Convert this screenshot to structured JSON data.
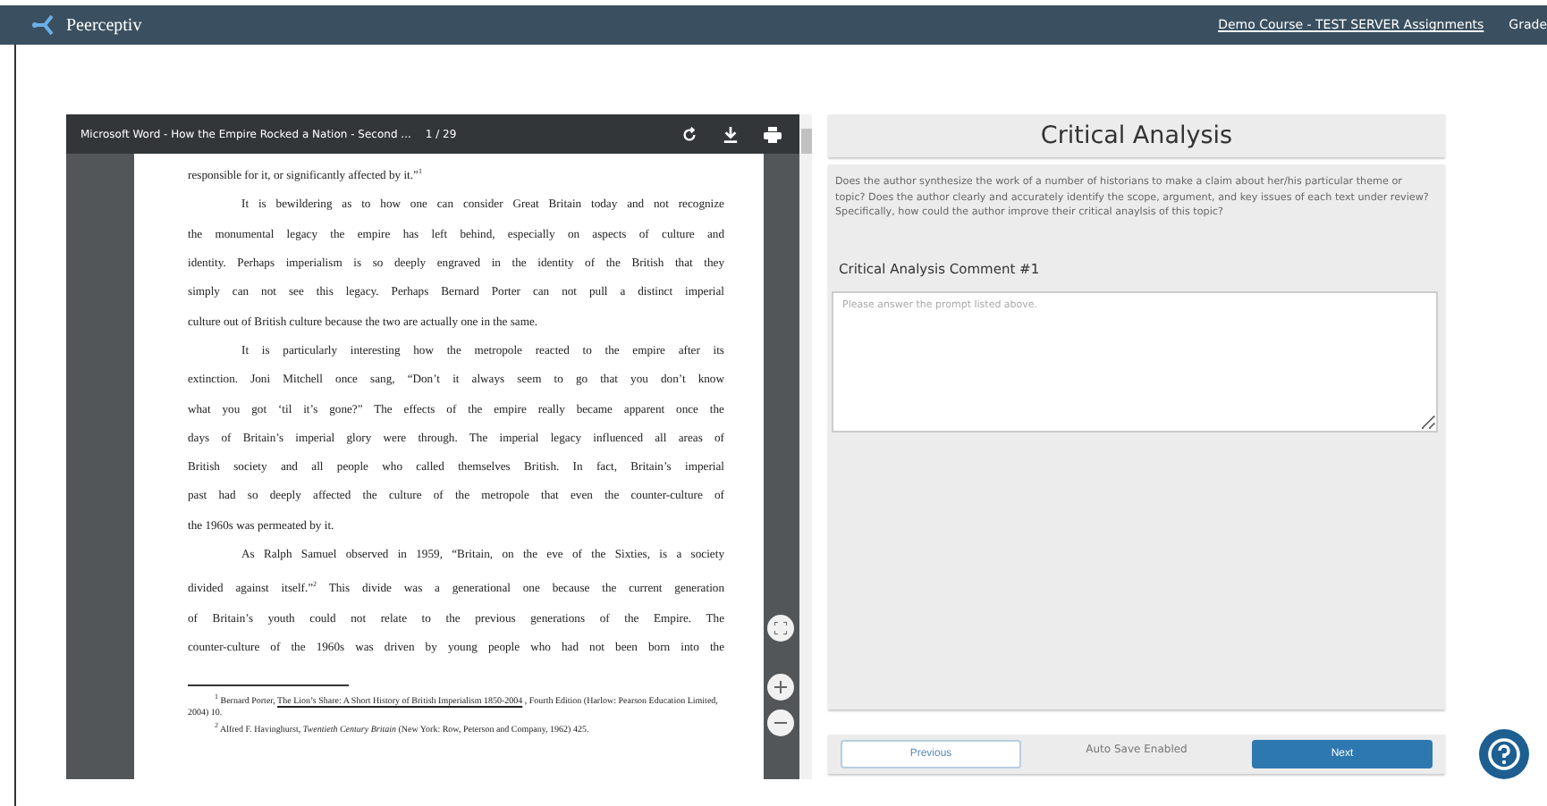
{
  "navbar": {
    "brand": "Peerceptiv",
    "course_link": "Demo Course - TEST SERVER Assignments",
    "grades_link": "Grade"
  },
  "pdf_viewer": {
    "title": "Microsoft Word - How the Empire Rocked a Nation - Second ...",
    "page_counter": "1 / 29",
    "lines": [
      {
        "kind": "last",
        "text": "responsible for it, or significantly affected by it.”$^{1}$"
      },
      {
        "kind": "indent",
        "text": "It is bewildering as to how one can consider Great Britain today and not recognize"
      },
      {
        "kind": "justify",
        "text": "the monumental legacy the empire has left behind, especially on aspects of culture and"
      },
      {
        "kind": "justify",
        "text": "identity. Perhaps imperialism is so deeply engraved in the identity of the British that they"
      },
      {
        "kind": "justify",
        "text": "simply can not see this legacy. Perhaps Bernard Porter can not pull a distinct imperial"
      },
      {
        "kind": "last",
        "text": "culture out of British culture because the two are actually one in the same."
      },
      {
        "kind": "indent",
        "text": "It is particularly interesting how the metropole reacted to the empire after its"
      },
      {
        "kind": "justify",
        "text": "extinction. Joni Mitchell once sang, “Don’t it always seem to go that you don’t know"
      },
      {
        "kind": "justify",
        "text": "what you got ‘til it’s gone?” The effects of the empire really became apparent once the"
      },
      {
        "kind": "justify",
        "text": "days of Britain’s imperial glory were through. The imperial legacy influenced all areas of"
      },
      {
        "kind": "justify",
        "text": "British society and all people who called themselves British. In fact, Britain’s imperial"
      },
      {
        "kind": "justify",
        "text": "past had so deeply affected the culture of the metropole that even the counter-culture of"
      },
      {
        "kind": "last",
        "text": "the 1960s was permeated by it."
      },
      {
        "kind": "indent",
        "text": "As Ralph Samuel observed in 1959, “Britain, on the eve of the Sixties, is a society"
      },
      {
        "kind": "justify",
        "text": "divided against itself.”$^{2}$ This divide was a generational one because the current generation"
      },
      {
        "kind": "justify",
        "text": "of Britain’s youth could not relate to the previous generations of the Empire. The"
      },
      {
        "kind": "justify",
        "text": "counter-culture of the 1960s was driven by young people who had not been born into the"
      }
    ],
    "footnotes": [
      [
        {
          "kind": "sup",
          "text": "1"
        },
        {
          "kind": "plain",
          "text": " Bernard Porter, "
        },
        {
          "kind": "title",
          "text": "The Lion’s Share: A Short History of British Imperialism 1850-2004"
        },
        {
          "kind": "plain",
          "text": " , Fourth Edition (Harlow: Pearson Education Limited, 2004) 10."
        }
      ],
      [
        {
          "kind": "sup",
          "text": "2"
        },
        {
          "kind": "plain",
          "text": " Alfred F. Havinghurst, "
        },
        {
          "kind": "book",
          "text": "Twentieth Century Britain"
        },
        {
          "kind": "plain",
          "text": " (New York: Row, Peterson and Company, 1962) 425."
        }
      ]
    ]
  },
  "review": {
    "title": "Critical Analysis",
    "prompt": "Does the author synthesize the work of a number of historians to make a claim about her/his particular theme or topic? Does the author clearly and accurately identify the scope, argument, and key issues of each text under review? Specifically, how could the author improve their critical anaylsis of this topic?",
    "comment_label": "Critical Analysis Comment #1",
    "comment": {
      "placeholder": "Please answer the prompt listed above."
    },
    "previous_button": "Previous",
    "autosave_status": "Auto Save Enabled",
    "next_button": "Next"
  }
}
